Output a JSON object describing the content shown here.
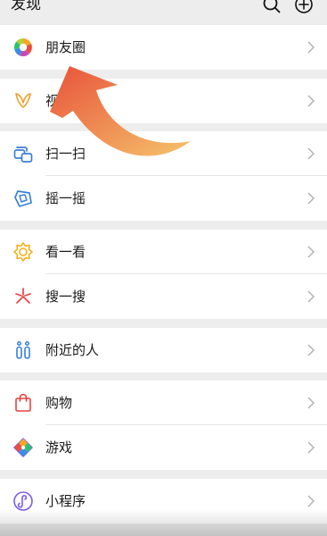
{
  "header": {
    "title": "发现",
    "search_icon": "search-icon",
    "add_icon": "add-circle-icon"
  },
  "sections": [
    {
      "items": [
        {
          "key": "moments",
          "label": "朋友圈",
          "icon": "moments-aperture-icon"
        }
      ]
    },
    {
      "items": [
        {
          "key": "channels",
          "label": "视",
          "icon": "channels-butterfly-icon"
        }
      ]
    },
    {
      "items": [
        {
          "key": "scan",
          "label": "扫一扫",
          "icon": "scan-icon"
        },
        {
          "key": "shake",
          "label": "摇一摇",
          "icon": "shake-icon"
        }
      ]
    },
    {
      "items": [
        {
          "key": "top_stories",
          "label": "看一看",
          "icon": "top-stories-icon"
        },
        {
          "key": "search",
          "label": "搜一搜",
          "icon": "search-sparkle-icon"
        }
      ]
    },
    {
      "items": [
        {
          "key": "nearby",
          "label": "附近的人",
          "icon": "people-nearby-icon"
        }
      ]
    },
    {
      "items": [
        {
          "key": "shopping",
          "label": "购物",
          "icon": "shopping-bag-icon"
        },
        {
          "key": "games",
          "label": "游戏",
          "icon": "games-diamond-icon"
        }
      ]
    },
    {
      "items": [
        {
          "key": "mini_programs",
          "label": "小程序",
          "icon": "mini-programs-icon"
        }
      ]
    }
  ],
  "overlay": {
    "icon": "curved-arrow-icon",
    "gradient_start": "#e8523a",
    "gradient_end": "#f5c26b"
  },
  "colors": {
    "background": "#ededed",
    "row_background": "#ffffff",
    "chevron": "#b2b2b2"
  }
}
